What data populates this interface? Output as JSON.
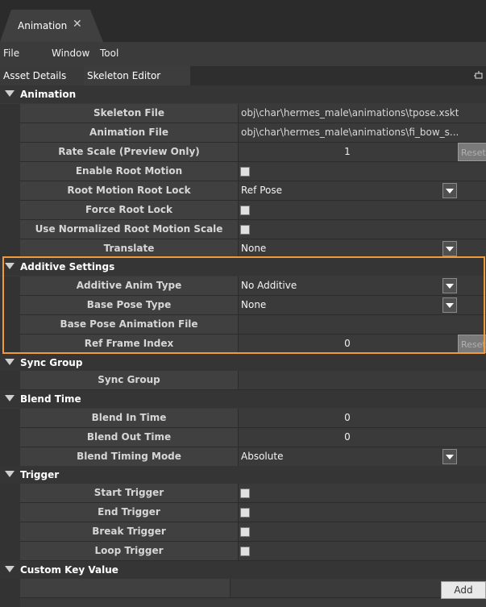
{
  "tab": {
    "title": "Animation",
    "close_icon": "close-icon"
  },
  "menu": {
    "file": "File",
    "window": "Window",
    "tool": "Tool"
  },
  "subtabs": {
    "asset_details": "Asset Details",
    "skeleton_editor": "Skeleton Editor"
  },
  "sections": {
    "animation": "Animation",
    "additive": "Additive Settings",
    "sync": "Sync Group",
    "blend": "Blend Time",
    "trigger": "Trigger",
    "custom": "Custom Key Value"
  },
  "rows": {
    "skeleton_file": {
      "label": "Skeleton File",
      "value": "obj\\char\\hermes_male\\animations\\tpose.xskt"
    },
    "animation_file": {
      "label": "Animation File",
      "value": "obj\\char\\hermes_male\\animations\\fi_bow_s..."
    },
    "rate_scale": {
      "label": "Rate Scale (Preview Only)",
      "value": "1",
      "reset": "Reset"
    },
    "enable_root_motion": {
      "label": "Enable Root Motion"
    },
    "root_motion_lock": {
      "label": "Root Motion Root Lock",
      "value": "Ref Pose"
    },
    "force_root_lock": {
      "label": "Force Root Lock"
    },
    "use_norm_scale": {
      "label": "Use Normalized Root Motion Scale"
    },
    "translate": {
      "label": "Translate",
      "value": "None"
    },
    "additive_type": {
      "label": "Additive Anim Type",
      "value": "No Additive"
    },
    "base_pose_type": {
      "label": "Base Pose Type",
      "value": "None"
    },
    "base_pose_file": {
      "label": "Base Pose Animation File",
      "value": ""
    },
    "ref_frame": {
      "label": "Ref Frame Index",
      "value": "0",
      "reset": "Reset"
    },
    "sync_group": {
      "label": "Sync Group",
      "value": ""
    },
    "blend_in": {
      "label": "Blend In Time",
      "value": "0"
    },
    "blend_out": {
      "label": "Blend Out Time",
      "value": "0"
    },
    "blend_mode": {
      "label": "Blend Timing Mode",
      "value": "Absolute"
    },
    "start_trigger": {
      "label": "Start Trigger"
    },
    "end_trigger": {
      "label": "End Trigger"
    },
    "break_trigger": {
      "label": "Break Trigger"
    },
    "loop_trigger": {
      "label": "Loop Trigger"
    }
  },
  "buttons": {
    "add": "Add"
  },
  "colors": {
    "highlight": "#f09a3a",
    "panel": "#3a3a3a",
    "header": "#353535"
  }
}
